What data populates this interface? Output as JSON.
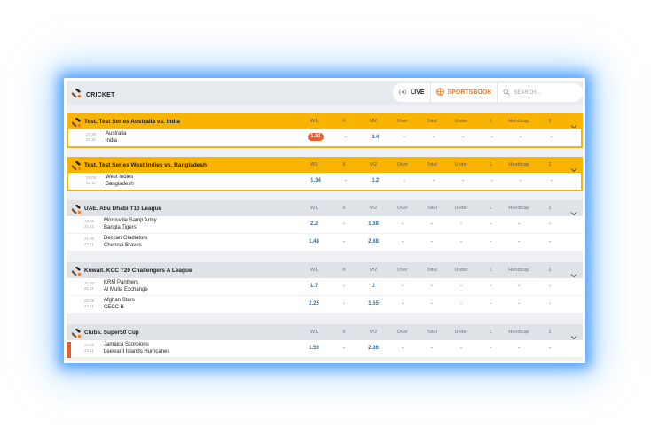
{
  "topbar": {
    "sport": "CRICKET",
    "live_label": "LIVE",
    "sportsbook_label": "SPORTSBOOK",
    "search_placeholder": "SEARCH..."
  },
  "columns": [
    "W1",
    "X",
    "W2",
    "Over",
    "Total",
    "Under",
    "1",
    "Handicap",
    "2"
  ],
  "colors": {
    "accent": "#f8b400",
    "brand": "#f47b20",
    "odd_highlight": "#ef5a2a",
    "odd_text": "#2a6fb5"
  },
  "leagues": [
    {
      "name": "Test. Test Series Australia vs. India",
      "highlight": true,
      "matches": [
        {
          "time": "07:30",
          "date": "22.11",
          "team1": "Australia",
          "team2": "India",
          "odds": [
            "1.91",
            "-",
            "3.4",
            "-",
            "-",
            "-",
            "-",
            "-",
            "-"
          ]
        }
      ]
    },
    {
      "name": "Test. Test Series West Indies vs. Bangladesh",
      "highlight": true,
      "matches": [
        {
          "time": "19:00",
          "date": "22.11",
          "team1": "West Indies",
          "team2": "Bangladesh",
          "odds": [
            "1.34",
            "-",
            "3.2",
            "-",
            "-",
            "-",
            "-",
            "-",
            "-"
          ]
        }
      ]
    },
    {
      "name": "UAE. Abu Dhabi T10 League",
      "highlight": false,
      "matches": [
        {
          "time": "18:45",
          "date": "21.11",
          "team1": "Morrisville Samp Army",
          "team2": "Bangla Tigers",
          "odds": [
            "2.2",
            "-",
            "1.68",
            "-",
            "-",
            "-",
            "-",
            "-",
            "-"
          ]
        },
        {
          "time": "21:00",
          "date": "21.11",
          "team1": "Deccan Gladiators",
          "team2": "Chennai Braves",
          "odds": [
            "1.48",
            "-",
            "2.68",
            "-",
            "-",
            "-",
            "-",
            "-",
            "-"
          ]
        }
      ]
    },
    {
      "name": "Kuwait. KCC T20 Challengers A League",
      "highlight": false,
      "matches": [
        {
          "time": "21:30",
          "date": "21.11",
          "team1": "KRM Panthers",
          "team2": "Al Mulla Exchange",
          "odds": [
            "1.7",
            "-",
            "2",
            "-",
            "-",
            "-",
            "-",
            "-",
            "-"
          ]
        },
        {
          "time": "00:45",
          "date": "22.11",
          "team1": "Afghan Stars",
          "team2": "CECC B",
          "odds": [
            "2.25",
            "-",
            "1.55",
            "-",
            "-",
            "-",
            "-",
            "-",
            "-"
          ]
        }
      ]
    },
    {
      "name": "Clubs. Super50 Cup",
      "highlight": false,
      "matches": [
        {
          "time": "22:00",
          "date": "21.11",
          "team1": "Jamaica Scorpions",
          "team2": "Leeward Islands Hurricanes",
          "odds": [
            "1.59",
            "-",
            "2.36",
            "-",
            "-",
            "-",
            "-",
            "-",
            "-"
          ]
        }
      ]
    }
  ]
}
